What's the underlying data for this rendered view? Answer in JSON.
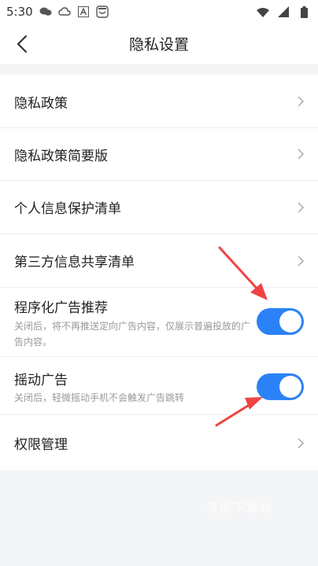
{
  "status_bar": {
    "time": "5:30"
  },
  "header": {
    "title": "隐私设置"
  },
  "items": [
    {
      "label": "隐私政策"
    },
    {
      "label": "隐私政策简要版"
    },
    {
      "label": "个人信息保护清单"
    },
    {
      "label": "第三方信息共享清单"
    },
    {
      "label": "程序化广告推荐",
      "desc": "关闭后，将不再推送定向广告内容，仅展示普遍投放的广告内容。",
      "toggle_on": true
    },
    {
      "label": "摇动广告",
      "desc": "关闭后，轻微摇动手机不会触发广告跳转",
      "toggle_on": true
    },
    {
      "label": "权限管理"
    }
  ],
  "watermark": "沃德下载站",
  "colors": {
    "accent": "#2b82f7",
    "annotation_arrow": "#ef4444"
  }
}
